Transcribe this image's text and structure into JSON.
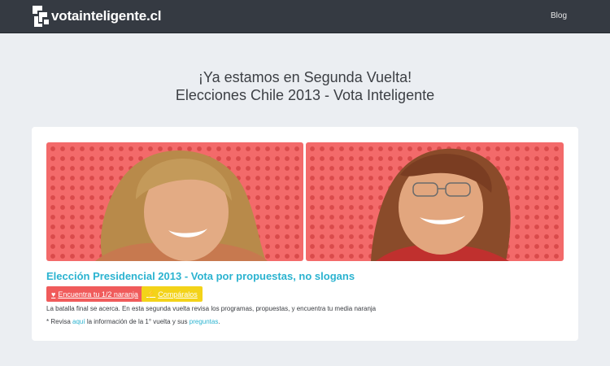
{
  "navbar": {
    "brand": "votainteligente.cl",
    "blog_link": "Blog"
  },
  "hero": {
    "line1": "¡Ya estamos en Segunda Vuelta!",
    "line2": "Elecciones Chile 2013 - Vota Inteligente"
  },
  "card": {
    "title": "Elección Presidencial 2013 - Vota por propuestas, no slogans",
    "match_button": "Encuentra tu 1/2 naranja",
    "match_icon": "heart-icon",
    "compare_button": "Compáralos",
    "compare_icon": "bolt-icon",
    "description": "La batalla final se acerca. En esta segunda vuelta revisa los programas, propuestas, y encuentra tu media naranja",
    "note_prefix": "* Revisa ",
    "note_link1": "aquí",
    "note_middle": " la información de la 1° vuelta y sus ",
    "note_link2": "preguntas",
    "note_suffix": "."
  },
  "colors": {
    "navbar_bg": "#353a42",
    "page_bg": "#ebeef2",
    "accent": "#2bb3d0",
    "panel_red": "#f36a6a",
    "button_red": "#f05b5b",
    "button_yellow": "#f3d319"
  }
}
